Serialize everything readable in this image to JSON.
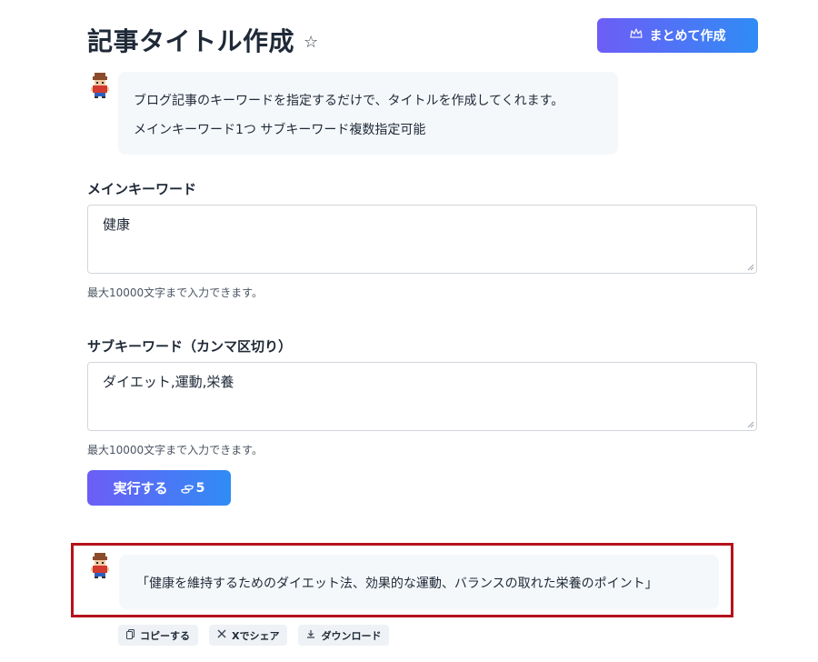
{
  "header": {
    "title": "記事タイトル作成",
    "favorite_icon": "star-outline-icon",
    "bulk_button_label": "まとめて作成",
    "bulk_button_icon": "crown-icon"
  },
  "intro": {
    "line1": "ブログ記事のキーワードを指定するだけで、タイトルを作成してくれます。",
    "line2": "メインキーワード1つ サブキーワード複数指定可能"
  },
  "main_keyword": {
    "label": "メインキーワード",
    "value": "健康",
    "hint": "最大10000文字まで入力できます。"
  },
  "sub_keyword": {
    "label": "サブキーワード（カンマ区切り）",
    "value": "ダイエット,運動,栄養",
    "hint": "最大10000文字まで入力できます。"
  },
  "run": {
    "label": "実行する",
    "cost": "5",
    "cost_icon": "coins-icon"
  },
  "result": {
    "text": "「健康を維持するためのダイエット法、効果的な運動、バランスの取れた栄養のポイント」"
  },
  "actions": {
    "copy": "コピーする",
    "share": "Xでシェア",
    "download": "ダウンロード"
  },
  "colors": {
    "button_gradient_start": "#6d5df6",
    "button_gradient_end": "#2f8cf5",
    "highlight_border": "#b5121b",
    "bubble_bg": "#f5f8fb"
  }
}
